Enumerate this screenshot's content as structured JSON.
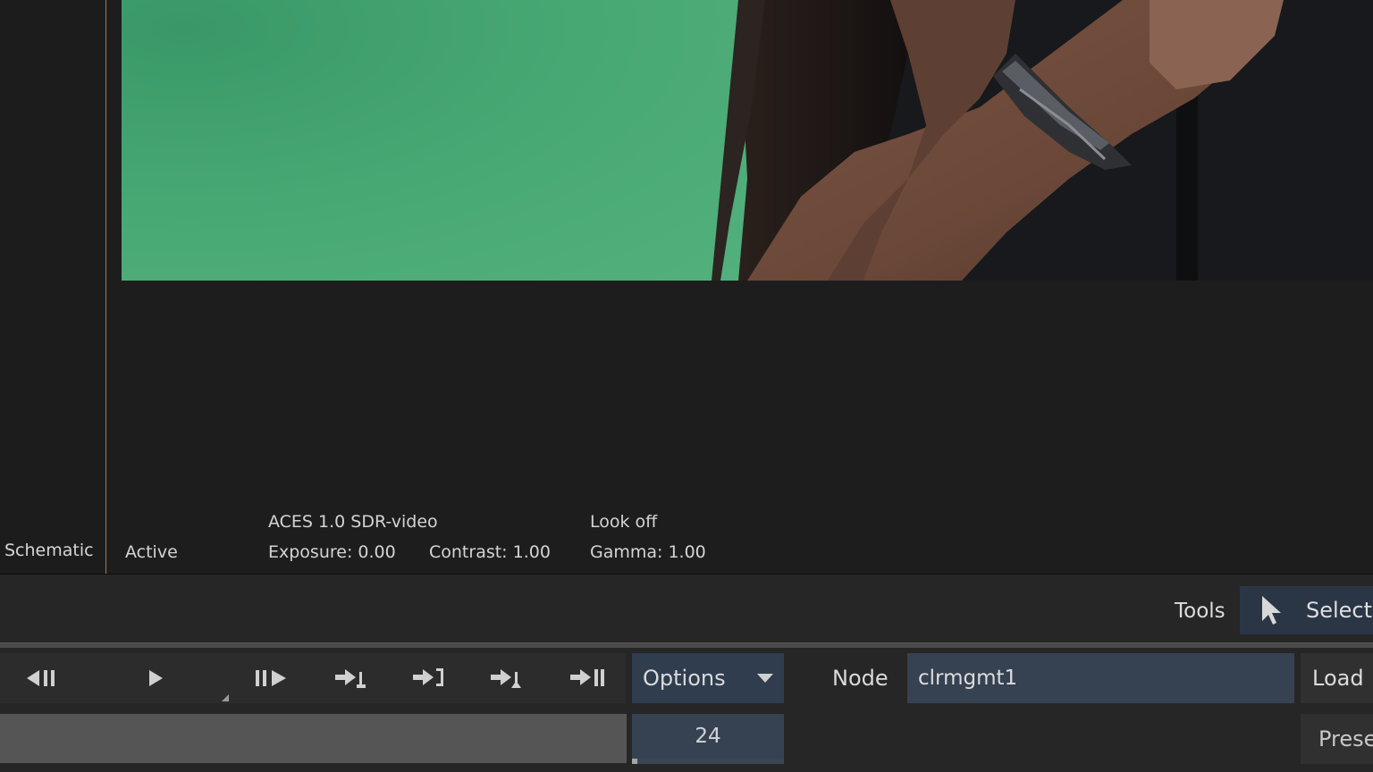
{
  "left_panel": {
    "label": "Schematic"
  },
  "viewer": {
    "image_description_colors": {
      "green_screen": "#4cab78",
      "skin": "#6b4a3c",
      "background_dark": "#15171a"
    },
    "status": {
      "mode": "Active",
      "view_transform": "ACES 1.0 SDR-video",
      "look": "Look off",
      "exposure": "Exposure: 0.00",
      "contrast": "Contrast: 1.00",
      "gamma": "Gamma: 1.00"
    }
  },
  "tools_bar": {
    "label": "Tools",
    "select_label": "Select",
    "select_icon": "pointer-arrow-icon"
  },
  "playback": {
    "buttons": [
      {
        "name": "step-back",
        "icon": "step-back-icon"
      },
      {
        "name": "play",
        "icon": "play-icon"
      },
      {
        "name": "step-forward",
        "icon": "step-forward-icon"
      },
      {
        "name": "go-to-in",
        "icon": "goto-in-icon"
      },
      {
        "name": "go-to-out",
        "icon": "goto-out-icon"
      },
      {
        "name": "go-to-marker",
        "icon": "goto-marker-icon"
      },
      {
        "name": "go-to-end",
        "icon": "goto-end-icon"
      }
    ],
    "options_label": "Options",
    "node_label": "Node",
    "node_value": "clrmgmt1",
    "load_label": "Load",
    "frame_value": "24",
    "preset_label": "Prese"
  },
  "colors": {
    "accent_blue": "#2f3d4f",
    "field_blue": "#364152",
    "panel_border": "#b3734a"
  }
}
